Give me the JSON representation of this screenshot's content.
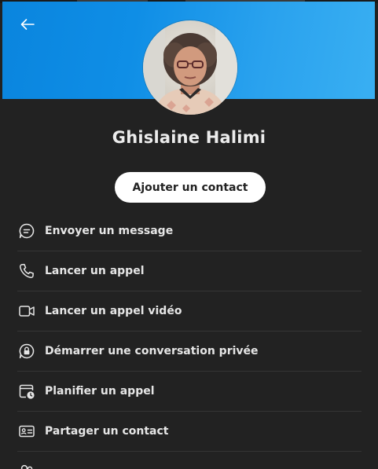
{
  "contact": {
    "name": "Ghislaine Halimi"
  },
  "header": {
    "back_icon": "arrow-left-icon"
  },
  "add_contact_label": "Ajouter un contact",
  "actions": [
    {
      "label": "Envoyer un message",
      "icon": "chat-bubble-icon"
    },
    {
      "label": "Lancer un appel",
      "icon": "phone-icon"
    },
    {
      "label": "Lancer un appel vidéo",
      "icon": "video-camera-icon"
    },
    {
      "label": "Démarrer une conversation privée",
      "icon": "private-chat-lock-icon"
    },
    {
      "label": "Planifier un appel",
      "icon": "calendar-clock-icon"
    },
    {
      "label": "Partager un contact",
      "icon": "contact-card-icon"
    },
    {
      "label": "",
      "icon": "people-icon"
    }
  ],
  "colors": {
    "banner_start": "#0a85de",
    "banner_end": "#39aff2",
    "background": "#222222",
    "text": "#e6e6e6",
    "button_bg": "#ffffff"
  }
}
